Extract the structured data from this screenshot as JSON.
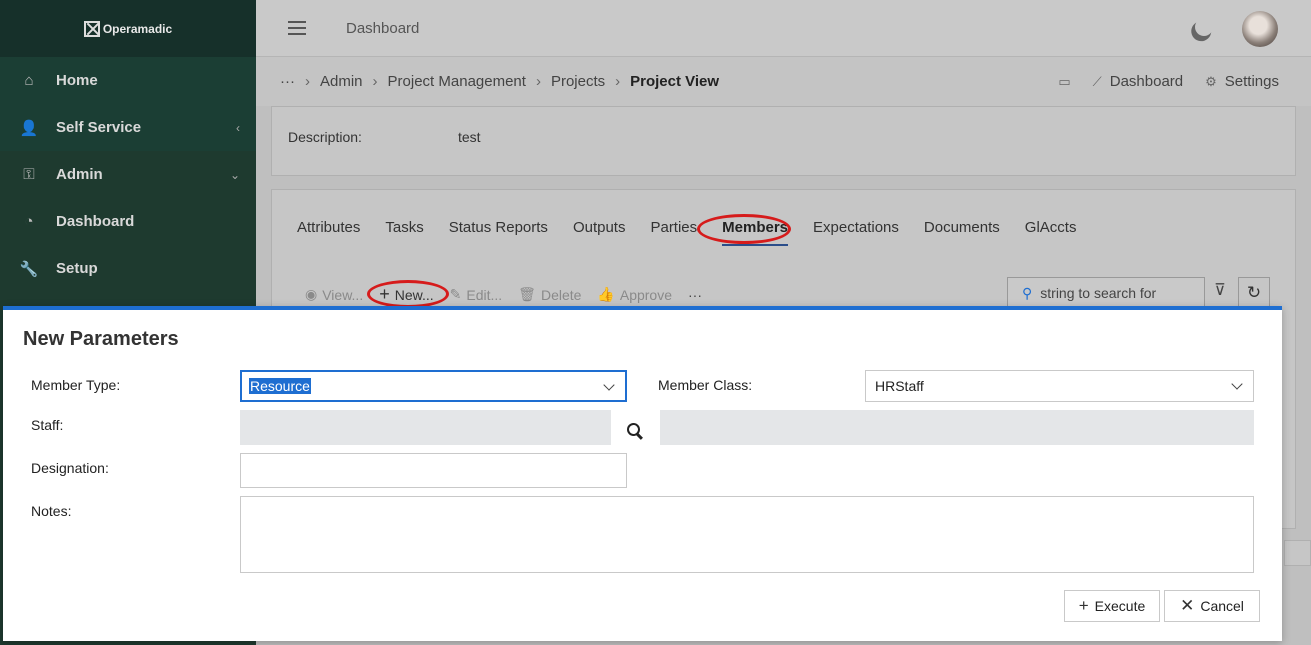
{
  "brand": {
    "name": "Operamadic"
  },
  "sidebar": {
    "items": [
      {
        "label": "Home",
        "icon": "home-icon"
      },
      {
        "label": "Self Service",
        "icon": "user-gear-icon"
      },
      {
        "label": "Admin",
        "icon": "key-icon"
      },
      {
        "label": "Dashboard",
        "icon": "gauge-icon"
      },
      {
        "label": "Setup",
        "icon": "wrench-icon"
      }
    ]
  },
  "header": {
    "title": "Dashboard"
  },
  "breadcrumb": {
    "more": "···",
    "items": [
      "Admin",
      "Project Management",
      "Projects",
      "Project View"
    ],
    "right": {
      "dashboard": "Dashboard",
      "settings": "Settings"
    }
  },
  "description": {
    "label": "Description:",
    "value": "test"
  },
  "tabs": [
    "Attributes",
    "Tasks",
    "Status Reports",
    "Outputs",
    "Parties",
    "Members",
    "Expectations",
    "Documents",
    "GlAccts"
  ],
  "toolbar": {
    "view": "View...",
    "new": "New...",
    "edit": "Edit...",
    "delete": "Delete",
    "approve": "Approve",
    "more": "···",
    "search_placeholder": "string to search for"
  },
  "modal": {
    "title": "New Parameters",
    "member_type_label": "Member Type:",
    "member_type_value": "Resource",
    "member_class_label": "Member Class:",
    "member_class_value": "HRStaff",
    "staff_label": "Staff:",
    "designation_label": "Designation:",
    "notes_label": "Notes:",
    "execute": "Execute",
    "cancel": "Cancel"
  },
  "colors": {
    "accent": "#1e6ed1",
    "sidebar": "#1e3a2f",
    "highlight_ring": "#d61b1b"
  }
}
